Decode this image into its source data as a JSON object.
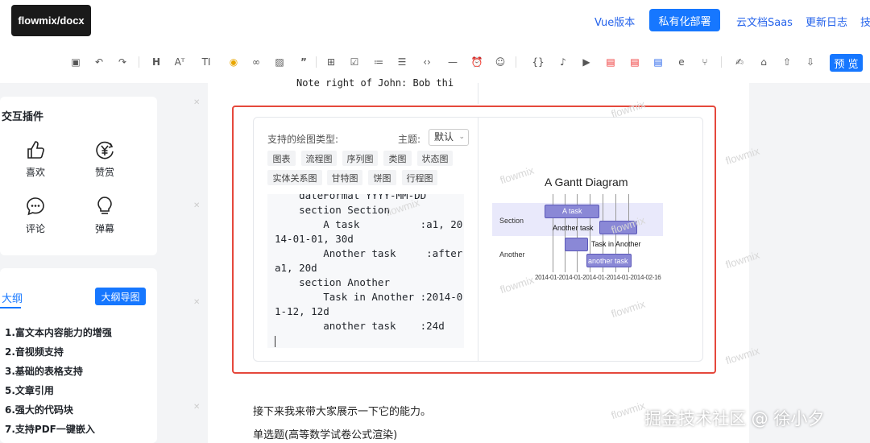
{
  "header": {
    "logo": "flowmix/docx",
    "nav": [
      "Vue版本",
      "私有化部署",
      "云文档Saas",
      "更新日志",
      "技"
    ],
    "preview": "预 览"
  },
  "toolbar": {
    "icons": [
      "save-icon",
      "undo-icon",
      "redo-icon",
      "heading-icon",
      "font-size-icon",
      "text-style-icon",
      "highlight-icon",
      "link-icon",
      "image-icon",
      "quote-icon",
      "table-icon",
      "checkbox-icon",
      "ordered-list-icon",
      "bullet-list-icon",
      "code-icon",
      "divider-icon",
      "alarm-icon",
      "emoji-icon",
      "braces-icon",
      "mic-icon",
      "video-icon",
      "pdf-icon",
      "pdf2-icon",
      "word-icon",
      "edge-icon",
      "git-icon",
      "sign-icon",
      "bank-icon",
      "upload-icon",
      "download-icon"
    ]
  },
  "plugins": {
    "title": "交互插件",
    "items": [
      {
        "label": "喜欢",
        "icon": "thumbs-up-icon"
      },
      {
        "label": "赞赏",
        "icon": "yen-icon"
      },
      {
        "label": "评论",
        "icon": "comment-icon"
      },
      {
        "label": "弹幕",
        "icon": "bulb-icon"
      }
    ]
  },
  "outline": {
    "tab": "大纲",
    "button": "大纲导图",
    "items": [
      "1.富文本内容能力的增强",
      "2.音视频支持",
      "3.基础的表格支持",
      "5.文章引用",
      "6.强大的代码块",
      "7.支持PDF一键嵌入"
    ]
  },
  "editor": {
    "snippet": "Note right of John: Bob thi",
    "diagram_block": {
      "types_label": "支持的绘图类型:",
      "theme_label": "主题:",
      "theme_value": "默认",
      "types": [
        "图表",
        "流程图",
        "序列图",
        "类图",
        "状态图",
        "实体关系图",
        "甘特图",
        "饼图",
        "行程图"
      ],
      "code_lines": [
        "    dateFormat YYYY-MM-DD",
        "    section Section",
        "        A task          :a1, 20",
        "14-01-01, 30d",
        "        Another task     :after",
        "a1, 20d",
        "    section Another",
        "        Task in Another :2014-0",
        "1-12, 12d",
        "        another task    :24d"
      ],
      "gantt": {
        "title": "A Gantt Diagram",
        "sections": [
          "Section",
          "Another"
        ],
        "tasks": [
          "A task",
          "Another task",
          "Task in Another",
          "another task"
        ],
        "axis": "2014-01-2014-01-2014-01-2014-01-2014-02-16",
        "bar_color": "#8a88d6"
      }
    },
    "paragraphs": [
      "接下来我来带大家展示一下它的能力。",
      "单选题(高等数学试卷公式渲染)"
    ]
  },
  "watermark": "flowmix",
  "corner_watermark": "掘金技术社区 @ 徐小夕",
  "colors": {
    "accent": "#1677ff",
    "highlight_border": "#e5483c"
  }
}
